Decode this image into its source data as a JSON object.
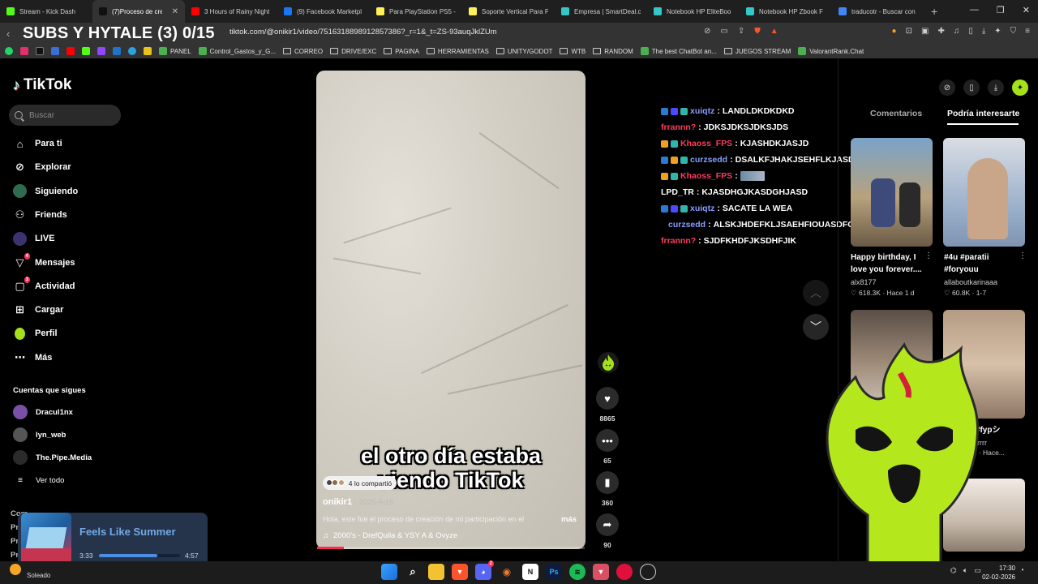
{
  "browser": {
    "tabs": [
      {
        "label": "Stream - Kick Dash",
        "color": "#53fc18"
      },
      {
        "label": "(7)Proceso de crea",
        "color": "#111111",
        "active": true
      },
      {
        "label": "3 Hours of Rainy Night",
        "color": "#ff0000"
      },
      {
        "label": "(9) Facebook Marketpl",
        "color": "#1877f2"
      },
      {
        "label": "Para PlayStation PS5 -",
        "color": "#fff159"
      },
      {
        "label": "Soporte Vertical Para P",
        "color": "#fff159"
      },
      {
        "label": "Empresa | SmartDeal.cl",
        "color": "#35c6c6"
      },
      {
        "label": "Notebook HP EliteBoo",
        "color": "#35c6c6"
      },
      {
        "label": "Notebook HP Zbook F",
        "color": "#35c6c6"
      },
      {
        "label": "traducotr - Buscar con",
        "color": "#4285f4"
      }
    ],
    "new_tab": "+",
    "stream_title": "SUBS Y HYTALE (3) 0/15",
    "url": "tiktok.com/@onikir1/video/7516318898912857386?_r=1&_t=ZS-93auqJklZUm",
    "bookmarks": [
      {
        "label": "PANEL",
        "type": "bm"
      },
      {
        "label": "Control_Gastos_y_G...",
        "type": "bm"
      },
      {
        "label": "CORREO",
        "type": "folder"
      },
      {
        "label": "DRIVE/EXC",
        "type": "folder"
      },
      {
        "label": "PAGINA",
        "type": "folder"
      },
      {
        "label": "HERRAMIENTAS",
        "type": "folder"
      },
      {
        "label": "UNITY/GODOT",
        "type": "folder"
      },
      {
        "label": "WTB",
        "type": "folder"
      },
      {
        "label": "RANDOM",
        "type": "folder"
      },
      {
        "label": "The best ChatBot an...",
        "type": "bm"
      },
      {
        "label": "JUEGOS STREAM",
        "type": "folder"
      },
      {
        "label": "ValorantRank.Chat",
        "type": "bm"
      }
    ]
  },
  "sidebar": {
    "logo": "TikTok",
    "search_placeholder": "Buscar",
    "menu": [
      {
        "label": "Para ti",
        "icon": "home-icon"
      },
      {
        "label": "Explorar",
        "icon": "compass-icon"
      },
      {
        "label": "Siguiendo",
        "icon": "avatar"
      },
      {
        "label": "Friends",
        "icon": "friends-icon"
      },
      {
        "label": "LIVE",
        "icon": "live-icon"
      },
      {
        "label": "Mensajes",
        "icon": "messages-icon",
        "badge": "4"
      },
      {
        "label": "Actividad",
        "icon": "activity-icon",
        "badge": "3"
      },
      {
        "label": "Cargar",
        "icon": "upload-icon"
      },
      {
        "label": "Perfil",
        "icon": "flame-icon"
      },
      {
        "label": "Más",
        "icon": "more-icon"
      }
    ],
    "following_header": "Cuentas que sigues",
    "following": [
      {
        "label": "Dracul1nx",
        "color": "#7a4fa8"
      },
      {
        "label": "lyn_web",
        "color": "#555555"
      },
      {
        "label": "The.Pipe.Media",
        "color": "#2b2b2b"
      },
      {
        "label": "Ver todo",
        "color": ""
      }
    ],
    "ghost_lines": [
      "Com",
      "Pr",
      "Pr",
      "Pr"
    ]
  },
  "video": {
    "caption_line1": "el otro día estaba",
    "caption_line2": "viendo TikTok",
    "shared": "4 lo compartió",
    "author": "onikir1",
    "date": " · 2025-6-15",
    "description": "Hola, este fue el proceso de creación de mi participación en el",
    "more": "más",
    "music": "2000's - DrefQuila & YSY A & Ovyze",
    "progress": 0.1
  },
  "actions": {
    "likes": "8865",
    "comments": "65",
    "saves": "360",
    "shares": "90"
  },
  "chat": [
    {
      "user": "xuiqtz",
      "color": "#8a9cff",
      "msg": "LANDLDKDKDKD",
      "badges": [
        "#2a7bd6",
        "#4a4aff",
        "#2fb6a8"
      ]
    },
    {
      "user": "frrannn?",
      "color": "#ff3b5c",
      "msg": "JDKSJDKSJDKSJDS",
      "badges": []
    },
    {
      "user": "Khaoss_FPS",
      "color": "#ff3b5c",
      "msg": "KJASHDKJASJD",
      "badges": [
        "#f0a020",
        "#2fb6a8"
      ]
    },
    {
      "user": "curzsedd",
      "color": "#8a9cff",
      "msg": "DSALKFJHAKJSEHFLKJASDF",
      "badges": [
        "#2a7bd6",
        "#f0a020",
        "#2fb6a8"
      ]
    },
    {
      "user": "Khaoss_FPS",
      "color": "#ff3b5c",
      "msg": "",
      "badges": [
        "#f0a020",
        "#2fb6a8"
      ],
      "emote": true
    },
    {
      "user": "LPD_TR",
      "color": "#ffffff",
      "msg": "KJASDHGJKASDGHJASD",
      "badges": []
    },
    {
      "user": "xuiqtz",
      "color": "#8a9cff",
      "msg": "SACATE LA WEA",
      "badges": [
        "#2a7bd6",
        "#4a4aff",
        "#2fb6a8"
      ]
    },
    {
      "user": "curzsedd",
      "color": "#8a9cff",
      "msg": "ALSKJHDEFKLJSAEHFIOUASDFOIAWES",
      "badges": [
        "#2a7bd6",
        "#f0a020",
        "#2fb6a8"
      ]
    },
    {
      "user": "frrannn?",
      "color": "#ff3b5c",
      "msg": "SJDFKHDFJKSDHFJIK",
      "badges": []
    }
  ],
  "right_panel": {
    "tab_comments": "Comentarios",
    "tab_suggested": "Podría interesarte",
    "cards": [
      {
        "title": "Happy birthday, I love you forever....",
        "author": "alx8177",
        "views": "618.3K",
        "time": "Hace 1 d"
      },
      {
        "title": "#4u #paratii #foryouu",
        "author": "allaboutkarinaaa",
        "views": "60.8K",
        "time": "1-7"
      },
      {
        "title": "",
        "author": "",
        "views": "",
        "time": ""
      },
      {
        "title": "ti #fypシ",
        "author": "rrrrrrr",
        "views": "3K",
        "time": "Hace..."
      }
    ]
  },
  "spotify": {
    "title": "Feels Like Summer",
    "current": "3:33",
    "total": "4:57",
    "progress": 0.72
  },
  "taskbar": {
    "weather": "Soleado",
    "time": "17:30",
    "date": "02-02-2026"
  }
}
